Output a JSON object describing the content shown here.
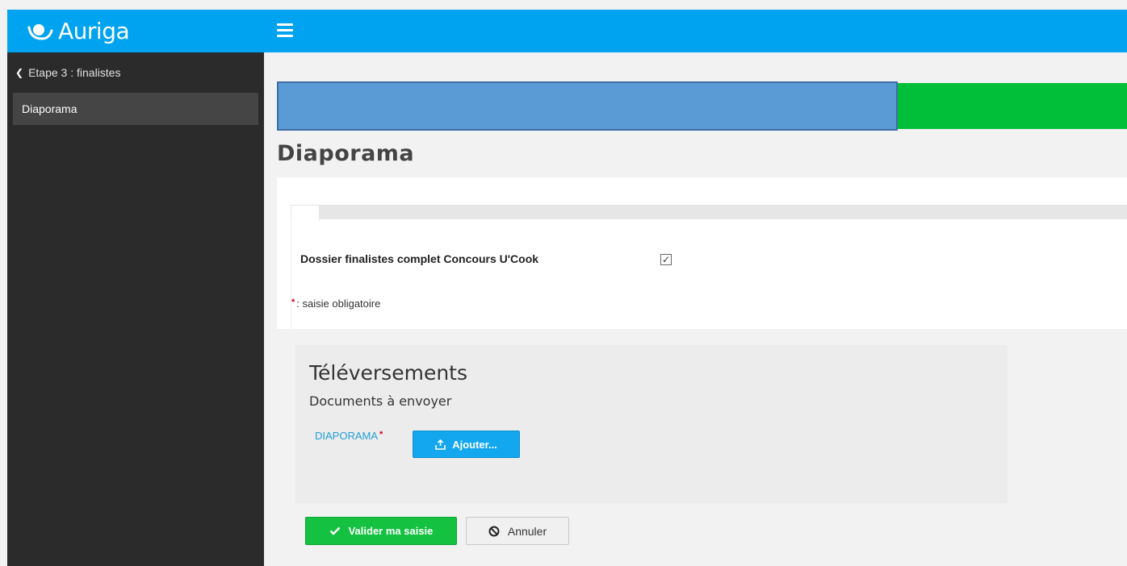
{
  "brand": {
    "name": "Auriga",
    "color": "#00a3ef"
  },
  "header": {
    "menu_icon": "hamburger-icon"
  },
  "sidebar": {
    "back_label": "Etape 3 : finalistes",
    "items": [
      {
        "label": "Diaporama",
        "active": true
      }
    ]
  },
  "progress": {
    "fraction_complete": 0.73,
    "colors": {
      "done": "#5b9bd5",
      "track": "#02bf3a"
    }
  },
  "page": {
    "title": "Diaporama"
  },
  "form": {
    "field_label": "Dossier finalistes complet Concours U'Cook",
    "checkbox_checked": true,
    "checkbox_glyph": "✓",
    "required_star": "*",
    "required_note": ": saisie obligatoire"
  },
  "uploads": {
    "title": "Téléversements",
    "subtitle": "Documents à envoyer",
    "documents": [
      {
        "label": "DIAPORAMA",
        "required_star": "*",
        "button_label": "Ajouter..."
      }
    ]
  },
  "actions": {
    "validate_label": "Valider ma saisie",
    "cancel_label": "Annuler",
    "validate_color": "#14c140"
  }
}
